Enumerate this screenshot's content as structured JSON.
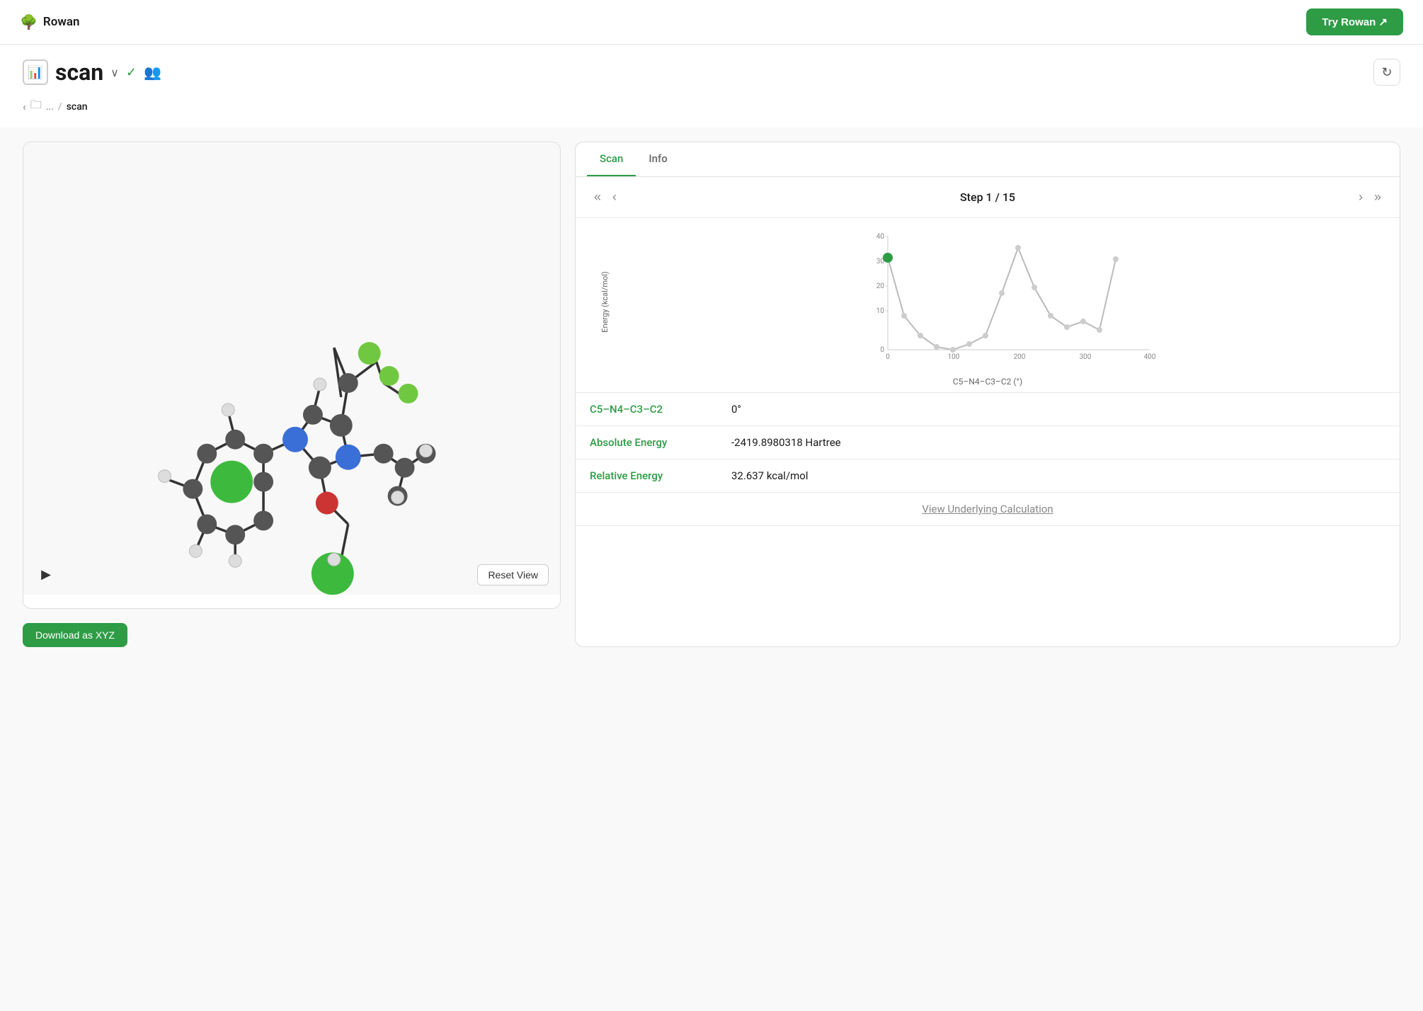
{
  "app": {
    "logo_emoji": "🌳",
    "logo_name": "Rowan",
    "try_rowan_label": "Try Rowan ↗"
  },
  "header": {
    "title_icon": "📊",
    "title": "scan",
    "chevron": "∨",
    "check": "✓",
    "users_icon": "👥",
    "refresh_icon": "↻",
    "breadcrumb_back": "‹",
    "breadcrumb_folder": "🗀",
    "breadcrumb_ellipsis": "...",
    "breadcrumb_sep": "/",
    "breadcrumb_current": "scan"
  },
  "tabs": {
    "scan_label": "Scan",
    "info_label": "Info"
  },
  "step_nav": {
    "first": "«",
    "prev": "‹",
    "next": "›",
    "last": "»",
    "step_label": "Step 1 / 15"
  },
  "chart": {
    "y_label": "Energy (kcal/mol)",
    "x_label": "C5–N4–C3–C2 (°)",
    "y_max": 40,
    "y_ticks": [
      40,
      30,
      20,
      10,
      0
    ],
    "x_ticks": [
      0,
      100,
      200,
      300,
      400
    ],
    "data_points": [
      {
        "x": 0,
        "y": 32.637
      },
      {
        "x": 25,
        "y": 12
      },
      {
        "x": 50,
        "y": 5
      },
      {
        "x": 75,
        "y": 1
      },
      {
        "x": 100,
        "y": 0
      },
      {
        "x": 125,
        "y": 2
      },
      {
        "x": 150,
        "y": 5
      },
      {
        "x": 175,
        "y": 20
      },
      {
        "x": 200,
        "y": 36
      },
      {
        "x": 225,
        "y": 22
      },
      {
        "x": 250,
        "y": 12
      },
      {
        "x": 275,
        "y": 8
      },
      {
        "x": 300,
        "y": 10
      },
      {
        "x": 325,
        "y": 7
      },
      {
        "x": 350,
        "y": 32
      }
    ],
    "active_point_index": 0,
    "accent_color": "#2d9c45"
  },
  "data_fields": {
    "dihedral_label": "C5–N4–C3–C2",
    "dihedral_value": "0°",
    "absolute_energy_label": "Absolute Energy",
    "absolute_energy_value": "-2419.8980318 Hartree",
    "relative_energy_label": "Relative Energy",
    "relative_energy_value": "32.637 kcal/mol",
    "view_calc_label": "View Underlying Calculation"
  },
  "molecule_viewer": {
    "play_icon": "▶",
    "reset_view_label": "Reset View",
    "download_xyz_label": "Download as XYZ"
  }
}
